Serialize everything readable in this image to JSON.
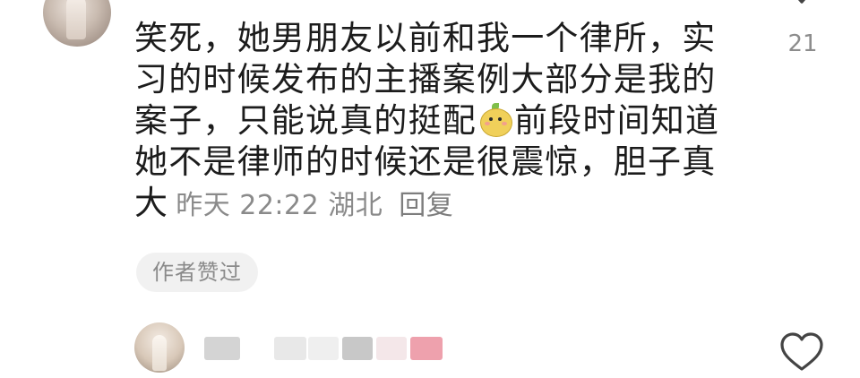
{
  "comment": {
    "lines": [
      "笑死，她男朋友以前和我一个律所，实",
      "习的时候发布的主播案例大部分是我的",
      "案子，只能说真的挺配",
      "前段时间知道",
      "她不是律师的时候还是很震惊，胆子真",
      "大"
    ],
    "emoji_icon": "mango-face-emoji",
    "time": "昨天 22:22",
    "location": "湖北",
    "reply_label": "回复",
    "author_liked_badge": "作者赞过",
    "like_count": "21"
  },
  "next_comment": {
    "username_blurred": true
  },
  "colors": {
    "text": "#1c1c1c",
    "meta": "#8a8a8a",
    "badge_bg": "#f1f1f1",
    "blur_pink": "#eea1ad"
  }
}
